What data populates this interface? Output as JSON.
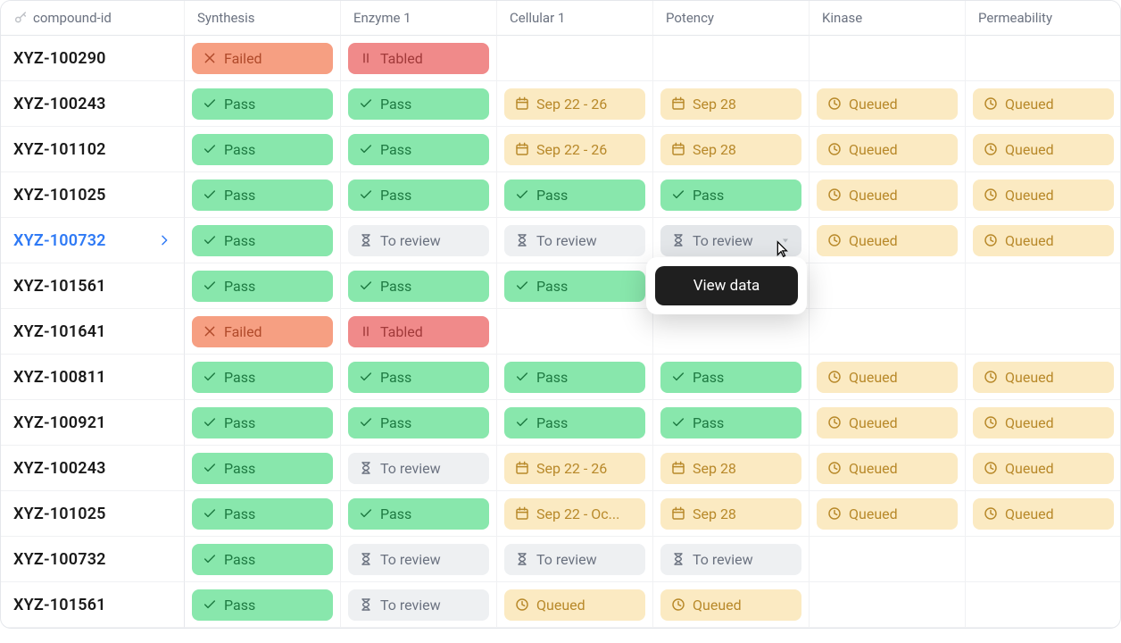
{
  "columns": [
    {
      "key": "id",
      "label": "compound-id",
      "icon": "key"
    },
    {
      "key": "synthesis",
      "label": "Synthesis"
    },
    {
      "key": "enzyme1",
      "label": "Enzyme 1"
    },
    {
      "key": "cellular1",
      "label": "Cellular 1"
    },
    {
      "key": "potency",
      "label": "Potency"
    },
    {
      "key": "kinase",
      "label": "Kinase"
    },
    {
      "key": "perm",
      "label": "Permeability"
    }
  ],
  "status_labels": {
    "pass": "Pass",
    "failed": "Failed",
    "tabled": "Tabled",
    "queued": "Queued",
    "review": "To review"
  },
  "popover": {
    "button_label": "View data"
  },
  "rows": [
    {
      "id": "XYZ-100290",
      "cells": [
        {
          "t": "failed"
        },
        {
          "t": "tabled"
        },
        {
          "t": "empty"
        },
        {
          "t": "empty"
        },
        {
          "t": "empty"
        },
        {
          "t": "empty"
        }
      ]
    },
    {
      "id": "XYZ-100243",
      "cells": [
        {
          "t": "pass"
        },
        {
          "t": "pass"
        },
        {
          "t": "date",
          "text": "Sep 22 - 26"
        },
        {
          "t": "date",
          "text": "Sep 28"
        },
        {
          "t": "queued"
        },
        {
          "t": "queued"
        }
      ]
    },
    {
      "id": "XYZ-101102",
      "cells": [
        {
          "t": "pass"
        },
        {
          "t": "pass"
        },
        {
          "t": "date",
          "text": "Sep 22 - 26"
        },
        {
          "t": "date",
          "text": "Sep 28"
        },
        {
          "t": "queued"
        },
        {
          "t": "queued"
        }
      ]
    },
    {
      "id": "XYZ-101025",
      "cells": [
        {
          "t": "pass"
        },
        {
          "t": "pass"
        },
        {
          "t": "pass"
        },
        {
          "t": "pass"
        },
        {
          "t": "queued"
        },
        {
          "t": "queued"
        }
      ]
    },
    {
      "id": "XYZ-100732",
      "active": true,
      "cells": [
        {
          "t": "pass"
        },
        {
          "t": "review"
        },
        {
          "t": "review"
        },
        {
          "t": "review",
          "hover": true,
          "caret": true,
          "popover": true
        },
        {
          "t": "queued"
        },
        {
          "t": "queued"
        }
      ]
    },
    {
      "id": "XYZ-101561",
      "cells": [
        {
          "t": "pass"
        },
        {
          "t": "pass"
        },
        {
          "t": "pass"
        },
        {
          "t": "empty"
        },
        {
          "t": "empty"
        },
        {
          "t": "empty"
        }
      ]
    },
    {
      "id": "XYZ-101641",
      "cells": [
        {
          "t": "failed"
        },
        {
          "t": "tabled"
        },
        {
          "t": "empty"
        },
        {
          "t": "empty"
        },
        {
          "t": "empty"
        },
        {
          "t": "empty"
        }
      ]
    },
    {
      "id": "XYZ-100811",
      "cells": [
        {
          "t": "pass"
        },
        {
          "t": "pass"
        },
        {
          "t": "pass"
        },
        {
          "t": "pass"
        },
        {
          "t": "queued"
        },
        {
          "t": "queued"
        }
      ]
    },
    {
      "id": "XYZ-100921",
      "cells": [
        {
          "t": "pass"
        },
        {
          "t": "pass"
        },
        {
          "t": "pass"
        },
        {
          "t": "pass"
        },
        {
          "t": "queued"
        },
        {
          "t": "queued"
        }
      ]
    },
    {
      "id": "XYZ-100243",
      "cells": [
        {
          "t": "pass"
        },
        {
          "t": "review"
        },
        {
          "t": "date",
          "text": "Sep 22 - 26"
        },
        {
          "t": "date",
          "text": "Sep 28"
        },
        {
          "t": "queued"
        },
        {
          "t": "queued"
        }
      ]
    },
    {
      "id": "XYZ-101025",
      "cells": [
        {
          "t": "pass"
        },
        {
          "t": "pass"
        },
        {
          "t": "date",
          "text": "Sep 22 - Oc..."
        },
        {
          "t": "date",
          "text": "Sep 28"
        },
        {
          "t": "queued"
        },
        {
          "t": "queued"
        }
      ]
    },
    {
      "id": "XYZ-100732",
      "cells": [
        {
          "t": "pass"
        },
        {
          "t": "review"
        },
        {
          "t": "review"
        },
        {
          "t": "review"
        },
        {
          "t": "empty"
        },
        {
          "t": "empty"
        }
      ]
    },
    {
      "id": "XYZ-101561",
      "cells": [
        {
          "t": "pass"
        },
        {
          "t": "review"
        },
        {
          "t": "queued"
        },
        {
          "t": "queued"
        },
        {
          "t": "empty"
        },
        {
          "t": "empty"
        }
      ]
    }
  ]
}
